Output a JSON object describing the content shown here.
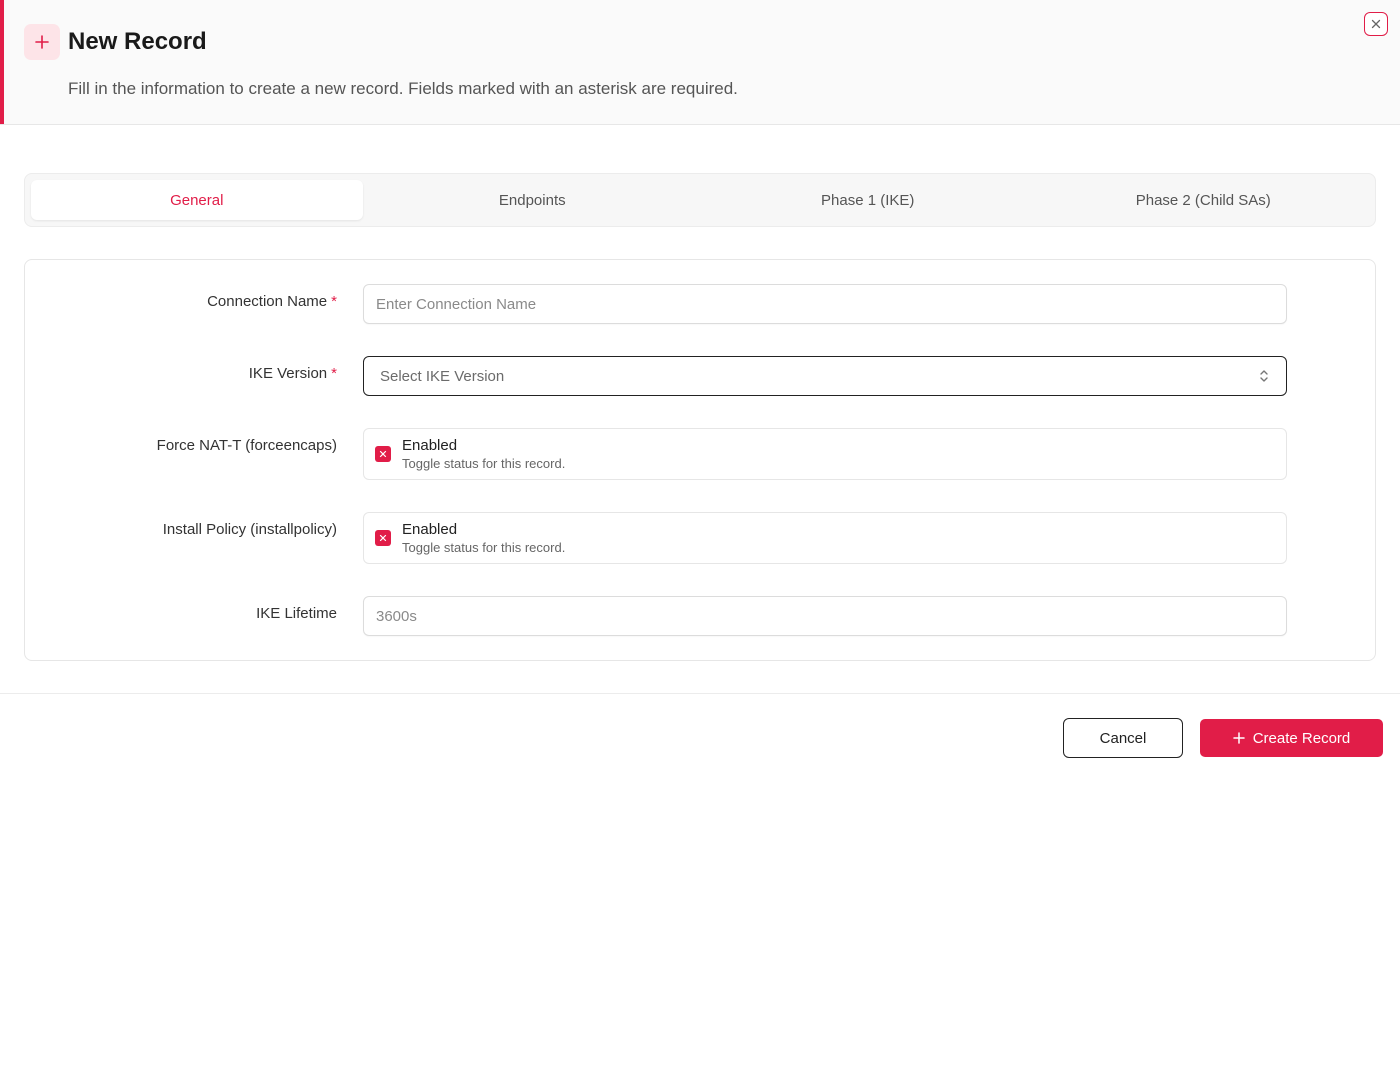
{
  "dialog": {
    "title": "New Record",
    "description": "Fill in the information to create a new record. Fields marked with an asterisk are required.",
    "accent_color": "#e11d48"
  },
  "tabs": [
    {
      "label": "General",
      "active": true
    },
    {
      "label": "Endpoints",
      "active": false
    },
    {
      "label": "Phase 1 (IKE)",
      "active": false
    },
    {
      "label": "Phase 2 (Child SAs)",
      "active": false
    }
  ],
  "form": {
    "connection_name": {
      "label": "Connection Name",
      "required_mark": "*",
      "placeholder": "Enter Connection Name",
      "value": ""
    },
    "ike_version": {
      "label": "IKE Version",
      "required_mark": "*",
      "placeholder": "Select IKE Version"
    },
    "force_nat_t": {
      "label": "Force NAT-T (forceencaps)",
      "status": "Enabled",
      "help": "Toggle status for this record.",
      "checked": true
    },
    "install_policy": {
      "label": "Install Policy (installpolicy)",
      "status": "Enabled",
      "help": "Toggle status for this record.",
      "checked": true
    },
    "ike_lifetime": {
      "label": "IKE Lifetime",
      "placeholder": "3600s",
      "value": ""
    }
  },
  "footer": {
    "cancel_label": "Cancel",
    "create_label": "Create Record"
  },
  "icons": {
    "header": "plus-icon",
    "close": "close-icon",
    "select": "chevron-up-down-icon",
    "checkbox": "x-mark-icon",
    "create": "plus-icon"
  }
}
